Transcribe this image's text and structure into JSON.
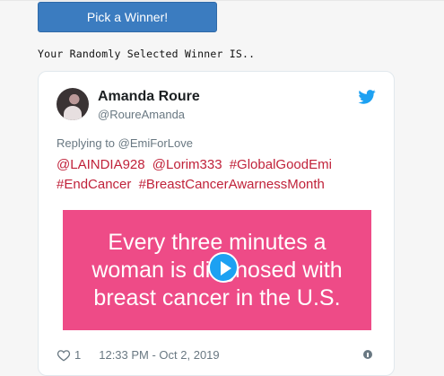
{
  "button": {
    "label": "Pick a Winner!"
  },
  "winner_label": "Your Randomly Selected Winner IS..",
  "tweet": {
    "author_name": "Amanda Roure",
    "author_handle": "@RoureAmanda",
    "replying_to": "Replying to @EmiForLove",
    "tokens": [
      "@LAINDIA928",
      "@Lorim333",
      "#GlobalGoodEmi",
      "#EndCancer",
      "#BreastCancerAwarnessMonth"
    ],
    "media_text": "Every three minutes a woman is diagnosed with breast cancer in the U.S.",
    "like_count": "1",
    "timestamp": "12:33 PM - Oct 2, 2019"
  },
  "colors": {
    "button": "#3b7cc0",
    "link": "#c0223a",
    "media_bg": "#ee4b87",
    "twitter_blue": "#1da1f2"
  },
  "icons": {
    "brand": "twitter-bird-icon",
    "play": "play-icon",
    "like": "heart-icon",
    "info": "info-icon"
  }
}
